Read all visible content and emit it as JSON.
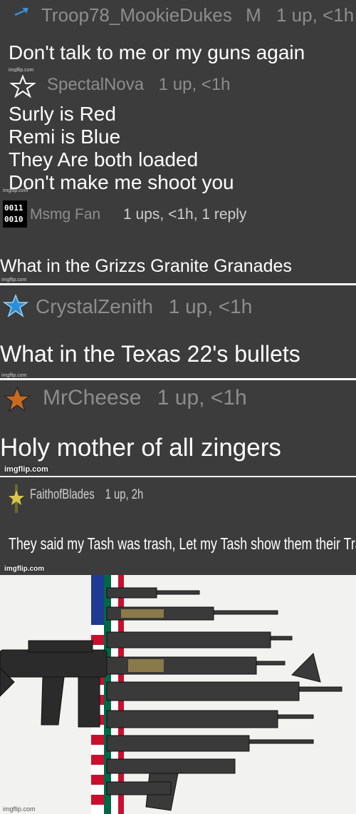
{
  "watermark": "imgflip.com",
  "comments": [
    {
      "username": "Troop78_MookieDukes",
      "badge": "M",
      "meta": "1 up, <1h",
      "lines": [
        "Don't talk to me or my guns again"
      ],
      "icon": "arrow-icon"
    },
    {
      "username": "SpectalNova",
      "meta": "1 up, <1h",
      "lines": [
        "Surly is Red",
        "Remi is Blue",
        "They Are both loaded",
        "Don't make me shoot you"
      ],
      "icon": "star-icon"
    },
    {
      "username": "Msmg Fan",
      "meta": "1 ups, <1h, 1 reply",
      "lines": [
        "What in the Grizzs Granite Granades"
      ],
      "icon": "binary-avatar-icon",
      "avatar_text": [
        "0011",
        "0010"
      ]
    },
    {
      "username": "CrystalZenith",
      "meta": "1 up, <1h",
      "lines": [
        "What in the Texas 22's bullets"
      ],
      "icon": "blue-star-icon"
    },
    {
      "username": "MrCheese",
      "meta": "1 up, <1h",
      "lines": [
        "Holy mother of all zingers"
      ],
      "icon": "orange-star-icon"
    },
    {
      "username": "FaithofBlades",
      "meta": "1 up, 2h",
      "lines": [
        "They said my Tash was trash, Let my Tash show them their Trash"
      ],
      "icon": "yellow-star-icon"
    }
  ],
  "colors": {
    "panel": "#3c3c3c",
    "text": "#ffffff",
    "meta": "#8d8d8d",
    "blue_star": "#2a8fd6",
    "orange_star": "#c86a1e",
    "yellow_star": "#d7c64a"
  },
  "image": {
    "description_icon": "rifles-image",
    "flag_colors": [
      "#c8102e",
      "#ffffff",
      "#006847",
      "#1f3a93"
    ]
  }
}
